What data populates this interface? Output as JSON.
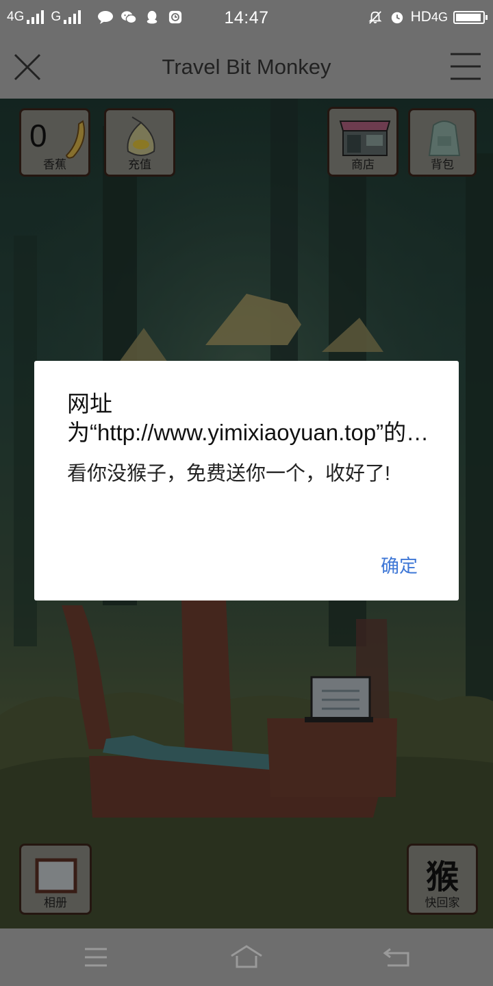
{
  "status_bar": {
    "network1": "4G",
    "network2": "G",
    "time": "14:47",
    "hd": "HD",
    "network3": "4G",
    "icons": [
      "signal-icon",
      "signal-icon",
      "chat-bubble-icon",
      "wechat-icon",
      "qq-icon",
      "app-icon",
      "mute-icon",
      "alarm-icon",
      "battery-icon"
    ],
    "battery_level": 0.95
  },
  "nav_bar": {
    "title": "Travel Bit Monkey",
    "close_icon": "close-icon",
    "menu_icon": "menu-icon"
  },
  "game": {
    "banana": {
      "count": "0",
      "label": "香蕉"
    },
    "recharge": {
      "label": "充值"
    },
    "shop": {
      "label": "商店"
    },
    "backpack": {
      "label": "背包"
    },
    "album": {
      "label": "相册"
    },
    "home": {
      "char": "猴",
      "label": "快回家"
    }
  },
  "dialog": {
    "title": "网址为“http://www.yimixiaoyuan.top”的…",
    "message": "看你没猴子，免费送你一个，收好了!",
    "confirm_label": "确定"
  },
  "system_nav": {
    "icons": [
      "menu-icon",
      "home-icon",
      "back-icon"
    ]
  },
  "colors": {
    "bars": "#6e6e6e",
    "link": "#3e77d6",
    "button_border": "#3a241a"
  }
}
